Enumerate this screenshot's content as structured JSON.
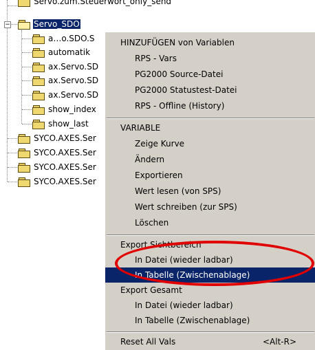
{
  "tree": {
    "top_item": "Servo.zum.Steuerwort_only_send",
    "selected_item": "Servo_SDO",
    "children": [
      "a…o.SDO.S",
      "automatik",
      "ax.Servo.SD",
      "ax.Servo.SD",
      "ax.Servo.SD",
      "show_index",
      "show_last"
    ],
    "siblings": [
      "SYCO.AXES.Ser",
      "SYCO.AXES.Ser",
      "SYCO.AXES.Ser",
      "SYCO.AXES.Ser"
    ]
  },
  "menu": {
    "header_add": "HINZUFÜGEN von Variablen",
    "add_items": [
      "RPS - Vars",
      "PG2000 Source-Datei",
      "PG2000 Statustest-Datei",
      "RPS - Offline (History)"
    ],
    "header_variable": "VARIABLE",
    "variable_items": [
      "Zeige Kurve",
      "Ändern",
      "Exportieren",
      "Wert lesen (von SPS)",
      "Wert schreiben (zur SPS)",
      "Löschen"
    ],
    "header_export_view": "Export Sichtbereich",
    "export_view_items": [
      "In Datei (wieder ladbar)",
      "In Tabelle (Zwischenablage)"
    ],
    "header_export_all": "Export Gesamt",
    "export_all_items": [
      "In Datei (wieder ladbar)",
      "In Tabelle (Zwischenablage)"
    ],
    "reset_label": "Reset All Vals",
    "reset_shortcut": "<Alt-R>"
  },
  "colors": {
    "highlight": "#0a246a",
    "menu_bg": "#d4d0c8",
    "annotation": "#e00000"
  }
}
